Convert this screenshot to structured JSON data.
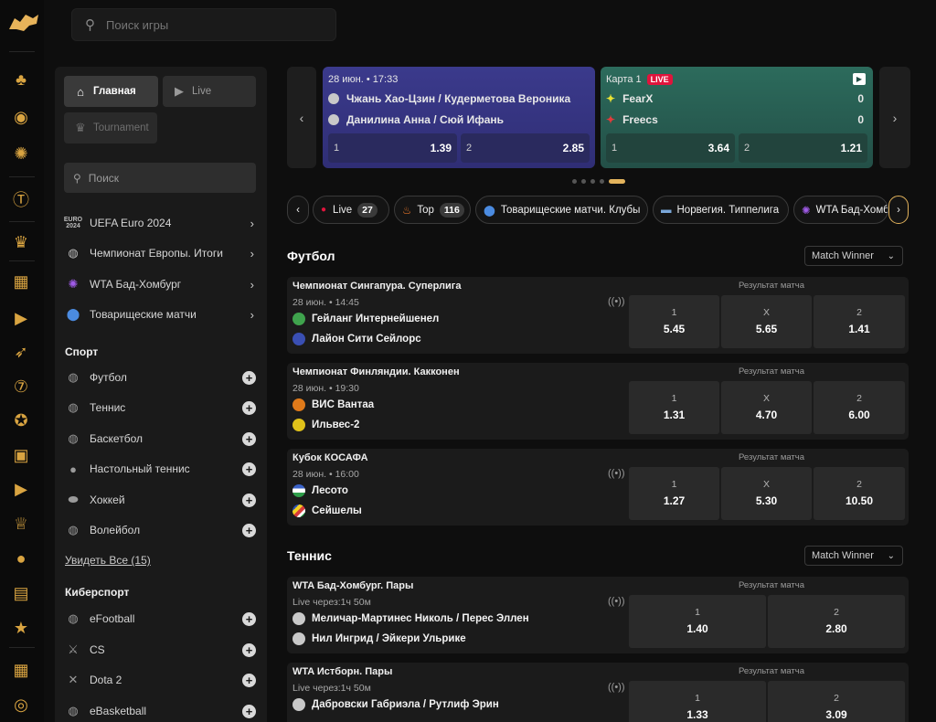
{
  "search": {
    "placeholder": "Поиск игры"
  },
  "sidebar": {
    "home": "Главная",
    "live": "Live",
    "tournament": "Tournament",
    "search": "Поиск",
    "featured": [
      {
        "icon": "euro-icon",
        "label": "UEFA Euro 2024",
        "logo_text": "EURO 2024"
      },
      {
        "icon": "ball-icon",
        "label": "Чемпионат Европы. Итоги"
      },
      {
        "icon": "wta-icon",
        "label": "WTA Бад-Хомбург"
      },
      {
        "icon": "friendly-icon",
        "label": "Товарищеские матчи"
      }
    ],
    "sport_title": "Спорт",
    "sports": [
      {
        "icon": "football-icon",
        "label": "Футбол"
      },
      {
        "icon": "tennis-icon",
        "label": "Теннис"
      },
      {
        "icon": "basketball-icon",
        "label": "Баскетбол"
      },
      {
        "icon": "table-tennis-icon",
        "label": "Настольный теннис"
      },
      {
        "icon": "hockey-icon",
        "label": "Хоккей"
      },
      {
        "icon": "volleyball-icon",
        "label": "Волейбол"
      }
    ],
    "see_all": "Увидеть Все (15)",
    "esport_title": "Киберспорт",
    "esports": [
      {
        "icon": "efootball-icon",
        "label": "eFootball"
      },
      {
        "icon": "cs-icon",
        "label": "CS"
      },
      {
        "icon": "dota-icon",
        "label": "Dota 2"
      },
      {
        "icon": "ebasketball-icon",
        "label": "eBasketball"
      }
    ]
  },
  "carousel": [
    {
      "header": "28 июн. • 17:33",
      "team1": "Чжань Хао-Цзин / Кудерметова Вероника",
      "team2": "Данилина Анна / Сюй Ифань",
      "o1_label": "1",
      "o1": "1.39",
      "o2_label": "2",
      "o2": "2.85"
    },
    {
      "header": "Карта 1",
      "live_badge": "LIVE",
      "team1": "FearX",
      "score1": "0",
      "team2": "Freecs",
      "score2": "0",
      "o1_label": "1",
      "o1": "3.64",
      "o2_label": "2",
      "o2": "1.21"
    }
  ],
  "chips": [
    {
      "label": "Live",
      "count": "27"
    },
    {
      "label": "Top",
      "count": "116"
    },
    {
      "label": "Товарищеские матчи. Клубы"
    },
    {
      "label": "Норвегия. Типпелига"
    },
    {
      "label": "WTA Бад-Хомб"
    }
  ],
  "sections": [
    {
      "title": "Футбол",
      "market": "Match Winner"
    },
    {
      "title": "Теннис",
      "market": "Match Winner"
    }
  ],
  "events": [
    {
      "league": "Чемпионат Сингапура. Суперлига",
      "market": "Результат матча",
      "time": "28 июн. • 14:45",
      "team1": "Гейланг Интернейшенел",
      "team2": "Лайон Сити Сейлорс",
      "odds": [
        {
          "k": "1",
          "v": "5.45"
        },
        {
          "k": "X",
          "v": "5.65"
        },
        {
          "k": "2",
          "v": "1.41"
        }
      ]
    },
    {
      "league": "Чемпионат Финляндии. Какконен",
      "market": "Результат матча",
      "time": "28 июн. • 19:30",
      "team1": "ВИС Вантаа",
      "team2": "Ильвес-2",
      "odds": [
        {
          "k": "1",
          "v": "1.31"
        },
        {
          "k": "X",
          "v": "4.70"
        },
        {
          "k": "2",
          "v": "6.00"
        }
      ]
    },
    {
      "league": "Кубок КОСАФА",
      "market": "Результат матча",
      "time": "28 июн. • 16:00",
      "team1": "Лесото",
      "team2": "Сейшелы",
      "odds": [
        {
          "k": "1",
          "v": "1.27"
        },
        {
          "k": "X",
          "v": "5.30"
        },
        {
          "k": "2",
          "v": "10.50"
        }
      ]
    },
    {
      "league": "WTA Бад-Хомбург. Пары",
      "market": "Результат матча",
      "time": "Live через:1ч 50м",
      "team1": "Меличар-Мартинес Николь / Перес Эллен",
      "team2": "Нил Ингрид / Эйкери Ульрике",
      "odds": [
        {
          "k": "1",
          "v": "1.40"
        },
        {
          "k": "2",
          "v": "2.80"
        }
      ]
    },
    {
      "league": "WTA Истборн. Пары",
      "market": "Результат матча",
      "time": "Live через:1ч 50м",
      "team1": "Дабровски Габриэла / Рутлиф Эрин",
      "team2": "",
      "odds": [
        {
          "k": "1",
          "v": "1.33"
        },
        {
          "k": "2",
          "v": "3.09"
        }
      ]
    }
  ],
  "colors": {
    "accent": "#e3b35c",
    "live": "#e0143c",
    "card1": "#3b3a8c",
    "card2": "#2c6b5c"
  }
}
